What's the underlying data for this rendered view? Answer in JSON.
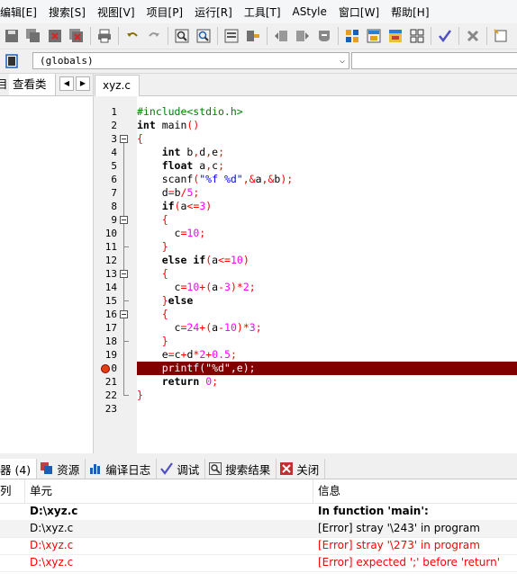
{
  "menu": [
    "编辑[E]",
    "搜索[S]",
    "视图[V]",
    "项目[P]",
    "运行[R]",
    "工具[T]",
    "AStyle",
    "窗口[W]",
    "帮助[H]"
  ],
  "scope_combo": {
    "value": "(globals)"
  },
  "left_tabs": {
    "partial": "目",
    "class_browser": "查看类"
  },
  "editor": {
    "tab": "xyz.c",
    "lines": [
      {
        "n": "1",
        "code": "#include<stdio.h>"
      },
      {
        "n": "2",
        "code": "int main()"
      },
      {
        "n": "3",
        "code": "{"
      },
      {
        "n": "4",
        "code": "    int b,d,e;"
      },
      {
        "n": "5",
        "code": "    float a,c;"
      },
      {
        "n": "6",
        "code": "    scanf(\"%f %d\",&a,&b);"
      },
      {
        "n": "7",
        "code": "    d=b/5;"
      },
      {
        "n": "8",
        "code": "    if(a<=3)"
      },
      {
        "n": "9",
        "code": "    {"
      },
      {
        "n": "10",
        "code": "      c=10;"
      },
      {
        "n": "11",
        "code": "    }"
      },
      {
        "n": "12",
        "code": "    else if(a<=10)"
      },
      {
        "n": "13",
        "code": "    {"
      },
      {
        "n": "14",
        "code": "      c=10+(a-3)*2;"
      },
      {
        "n": "15",
        "code": "    }else"
      },
      {
        "n": "16",
        "code": "    {"
      },
      {
        "n": "17",
        "code": "      c=24+(a-10)*3;"
      },
      {
        "n": "18",
        "code": "    }"
      },
      {
        "n": "19",
        "code": "    e=c+d*2+0.5;"
      },
      {
        "n": "20",
        "code": "    printf(\"%d\",e);"
      },
      {
        "n": "21",
        "code": "    return 0;"
      },
      {
        "n": "22",
        "code": "}"
      },
      {
        "n": "23",
        "code": ""
      }
    ],
    "error_line": "20"
  },
  "bottom_tabs": [
    {
      "label": "器 (4)",
      "icon": "compiler-icon"
    },
    {
      "label": "资源",
      "icon": "resources-icon"
    },
    {
      "label": "编译日志",
      "icon": "compile-log-icon"
    },
    {
      "label": "调试",
      "icon": "debug-check-icon"
    },
    {
      "label": "搜索结果",
      "icon": "search-results-icon"
    },
    {
      "label": "关闭",
      "icon": "close-icon"
    }
  ],
  "messages": {
    "headers": {
      "col0": "列",
      "unit": "单元",
      "info": "信息"
    },
    "rows": [
      {
        "unit": "D:\\xyz.c",
        "info": "In function 'main':",
        "style": "bold"
      },
      {
        "unit": "D:\\xyz.c",
        "info": "[Error] stray '\\243' in program",
        "style": "normal"
      },
      {
        "unit": "D:\\xyz.c",
        "info": "[Error] stray '\\273' in program",
        "style": "error"
      },
      {
        "unit": "D:\\xyz.c",
        "info": "[Error] expected ';' before 'return'",
        "style": "error"
      }
    ]
  },
  "colors": {
    "error_line_bg": "#800000",
    "keyword": "#000000",
    "preprocessor": "#008000",
    "symbol": "#ff0000",
    "string": "#0000ff",
    "number": "#ff00ff"
  }
}
